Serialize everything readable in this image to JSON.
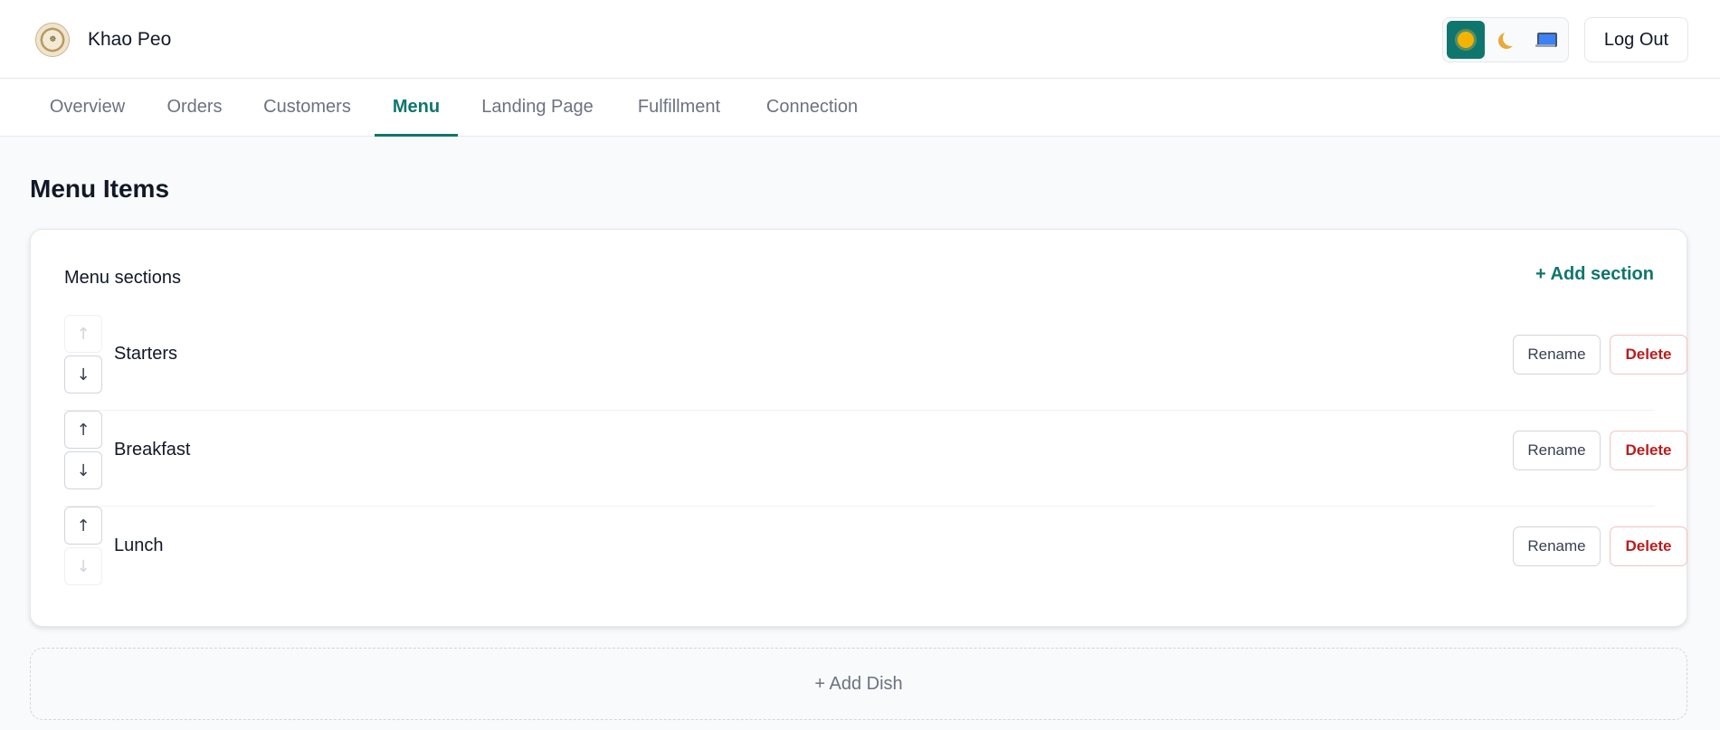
{
  "app": {
    "name": "Khao Peo",
    "logo_text": "KHAO PEO"
  },
  "header": {
    "theme_options": [
      {
        "name": "light",
        "icon": "sun-icon",
        "active": true
      },
      {
        "name": "dark",
        "icon": "moon-icon",
        "active": false
      },
      {
        "name": "system",
        "icon": "laptop-icon",
        "active": false
      }
    ],
    "logout_label": "Log Out"
  },
  "tabs": [
    {
      "label": "Overview",
      "active": false
    },
    {
      "label": "Orders",
      "active": false
    },
    {
      "label": "Customers",
      "active": false
    },
    {
      "label": "Menu",
      "active": true
    },
    {
      "label": "Landing Page",
      "active": false
    },
    {
      "label": "Fulfillment",
      "active": false
    },
    {
      "label": "Connection",
      "active": false
    }
  ],
  "page": {
    "title": "Menu Items"
  },
  "sections_card": {
    "title": "Menu sections",
    "add_section_label": "+ Add section",
    "rename_label": "Rename",
    "delete_label": "Delete",
    "up_arrow": "↑",
    "down_arrow": "↓",
    "sections": [
      {
        "name": "Starters",
        "can_move_up": false,
        "can_move_down": true
      },
      {
        "name": "Breakfast",
        "can_move_up": true,
        "can_move_down": true
      },
      {
        "name": "Lunch",
        "can_move_up": true,
        "can_move_down": false
      }
    ]
  },
  "add_dish_label": "+ Add Dish",
  "colors": {
    "accent": "#0f766e",
    "danger": "#b91c1c",
    "muted": "#6b7280"
  }
}
